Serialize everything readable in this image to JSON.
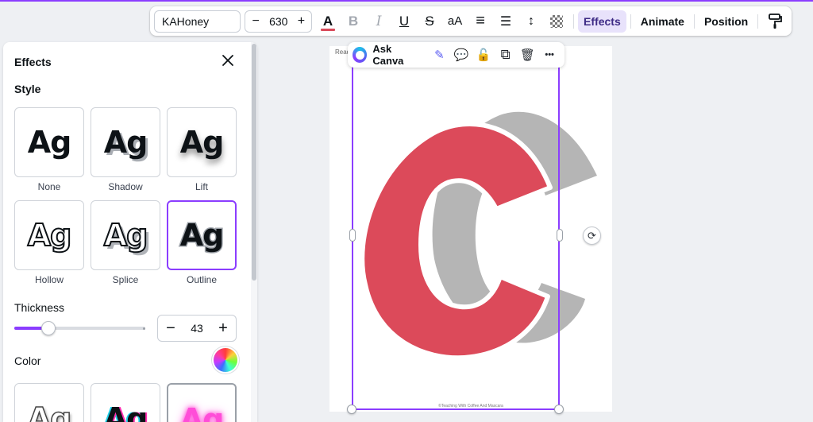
{
  "toolbar": {
    "font_name": "KAHoney",
    "font_size": "630",
    "decrease_glyph": "−",
    "increase_glyph": "+",
    "text_color": "#d94a5a",
    "icons": {
      "text_color": "A",
      "bold": "B",
      "italic": "I",
      "underline": "U",
      "strikethrough": "S",
      "case": "aA",
      "align": "≡",
      "list": "☰",
      "spacing": "↕"
    },
    "effects_label": "Effects",
    "animate_label": "Animate",
    "position_label": "Position",
    "paint_format_glyph": "🖌"
  },
  "effects_panel": {
    "title": "Effects",
    "style_label": "Style",
    "styles": [
      {
        "label": "None",
        "preview": "Ag"
      },
      {
        "label": "Shadow",
        "preview": "Ag"
      },
      {
        "label": "Lift",
        "preview": "Ag"
      },
      {
        "label": "Hollow",
        "preview": "Ag"
      },
      {
        "label": "Splice",
        "preview": "Ag"
      },
      {
        "label": "Outline",
        "preview": "Ag"
      }
    ],
    "selected_style": "Outline",
    "thickness_label": "Thickness",
    "thickness_value": "43",
    "thickness_fraction": 0.43,
    "color_label": "Color",
    "color_presets": [
      {
        "preview": "Ag"
      },
      {
        "preview": "Ag"
      },
      {
        "preview": "Ag"
      }
    ],
    "accent_color": "#8b3dff"
  },
  "canvas": {
    "page_header": "Read",
    "page_footer": "©Teaching With Coffee And Mascara",
    "letter": "C",
    "letter_color": "#dc4a5a",
    "outline_color": "#ffffff",
    "shadow_color": "#b5b5b5"
  },
  "ask_bar": {
    "label": "Ask Canva",
    "icons": {
      "magic_edit": "✎",
      "comment": "💬",
      "lock": "🔓",
      "duplicate": "⧉",
      "delete": "🗑",
      "more": "•••"
    }
  },
  "rotate_glyph": "⟳"
}
